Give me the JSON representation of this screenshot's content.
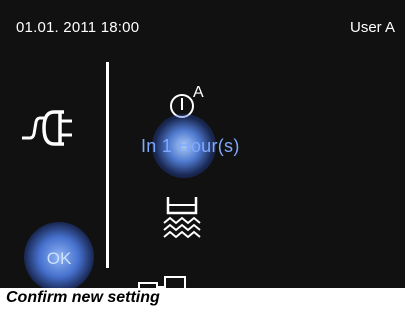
{
  "status": {
    "datetime": "01.01. 2011 18:00",
    "user": "User A"
  },
  "icons": {
    "left": "power-plug-icon",
    "timer": "timer-icon",
    "bath": "bath-heating-icon",
    "bottom": "building-icon"
  },
  "timer_badge": "A",
  "duration_label": "In 1 Hour(s)",
  "ok_button": "OK",
  "caption": "Confirm new setting",
  "colors": {
    "background": "#111111",
    "text": "#ffffff",
    "highlight": "#7fa9ff"
  }
}
